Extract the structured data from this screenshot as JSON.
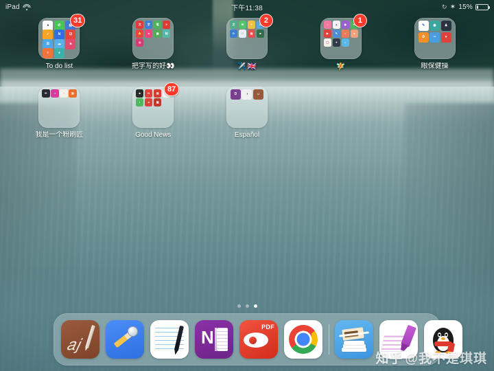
{
  "status_bar": {
    "device_label": "iPad",
    "wifi_icon": "wifi-icon",
    "time": "下午11:38",
    "rotation_lock_icon": "rotation-lock-icon",
    "bluetooth_icon": "bluetooth-icon",
    "battery_percent": "15%",
    "battery_level": 15
  },
  "home_screen": {
    "folders": [
      {
        "name": "To do list",
        "badge": "31",
        "columns": 3,
        "icons": [
          {
            "name": "contacts-app",
            "color": "#ffffff",
            "glyph": "●",
            "glyph_color": "#333333"
          },
          {
            "name": "whatsapp-app",
            "color": "#45c655",
            "glyph": "✆"
          },
          {
            "name": "calendar-app",
            "color": "#3e7bd6",
            "glyph": "▤"
          },
          {
            "name": "reminders-app",
            "color": "#f5a623",
            "glyph": "✓"
          },
          {
            "name": "notes-blue-app",
            "color": "#2f6fe0",
            "glyph": "N"
          },
          {
            "name": "todo-red-app",
            "color": "#e8453c",
            "glyph": "☑"
          },
          {
            "name": "tasks-app",
            "color": "#4ea7e8",
            "glyph": "☰"
          },
          {
            "name": "cloud-app",
            "color": "#58b0e8",
            "glyph": "☁"
          },
          {
            "name": "planner-app",
            "color": "#e24b6e",
            "glyph": "■"
          },
          {
            "name": "orange-list-app",
            "color": "#f0733c",
            "glyph": "≡"
          },
          {
            "name": "teal-app",
            "color": "#3fb0a8",
            "glyph": "●"
          }
        ]
      },
      {
        "name": "把字写的好👀",
        "badge": null,
        "columns": 4,
        "icons": [
          {
            "name": "calligraphy-app",
            "color": "#e23b3b",
            "glyph": "文"
          },
          {
            "name": "blue-write-app",
            "color": "#3f7fd8",
            "glyph": "字"
          },
          {
            "name": "green-write-app",
            "color": "#4eb35c",
            "glyph": "笔"
          },
          {
            "name": "red-x-app",
            "color": "#e0392f",
            "glyph": "✕"
          },
          {
            "name": "shop-app",
            "color": "#e8453c",
            "glyph": "⭐"
          },
          {
            "name": "pink-app",
            "color": "#e8487a",
            "glyph": "a"
          },
          {
            "name": "green-grid-app",
            "color": "#4fae57",
            "glyph": "▦"
          },
          {
            "name": "mint-app",
            "color": "#55b8a8",
            "glyph": "帖"
          },
          {
            "name": "insta-app",
            "color": "#d63b72",
            "glyph": "◎"
          }
        ]
      },
      {
        "name": "✈️🇬🇧",
        "badge": "2",
        "columns": 4,
        "icons": [
          {
            "name": "translate-app",
            "color": "#4fae8d",
            "glyph": "文"
          },
          {
            "name": "green-chat-app",
            "color": "#52c36b",
            "glyph": "✉"
          },
          {
            "name": "yellow-plus-app",
            "color": "#f0c040",
            "glyph": "+"
          },
          {
            "name": "gear-blue-app",
            "color": "#5aa8d8",
            "glyph": "⚙"
          },
          {
            "name": "dict-app",
            "color": "#3d7fd0",
            "glyph": "D"
          },
          {
            "name": "white-card-app",
            "color": "#e8eef2",
            "glyph": "□",
            "glyph_color": "#555555"
          },
          {
            "name": "flag-app",
            "color": "#e05050",
            "glyph": "▤"
          },
          {
            "name": "dark-green-app",
            "color": "#2f6f4a",
            "glyph": "■"
          }
        ]
      },
      {
        "name": "🧚",
        "badge": "1",
        "columns": 4,
        "icons": [
          {
            "name": "pink-music-app",
            "color": "#f07aa0",
            "glyph": "♪"
          },
          {
            "name": "white-art-app",
            "color": "#f2f2f2",
            "glyph": "▲",
            "glyph_color": "#7a4fd0"
          },
          {
            "name": "purple-cam-app",
            "color": "#9b5fd0",
            "glyph": "◉"
          },
          {
            "name": "green-leaf-app",
            "color": "#4fb85e",
            "glyph": "☘"
          },
          {
            "name": "red-play-app",
            "color": "#e0413c",
            "glyph": "▶"
          },
          {
            "name": "blue-draw-app",
            "color": "#4a8fd8",
            "glyph": "✎"
          },
          {
            "name": "coral-app",
            "color": "#f07a5a",
            "glyph": "◐"
          },
          {
            "name": "peach-app",
            "color": "#f0a07a",
            "glyph": "●"
          },
          {
            "name": "white-circle-app",
            "color": "#f5f0ea",
            "glyph": "◯",
            "glyph_color": "#c05a8a"
          },
          {
            "name": "dark-star-app",
            "color": "#2f3b4a",
            "glyph": "✦"
          },
          {
            "name": "sky-app",
            "color": "#5ab8e8",
            "glyph": "☼"
          }
        ]
      },
      {
        "name": "眼保健操",
        "badge": null,
        "columns": 3,
        "icons": [
          {
            "name": "white-note-app",
            "color": "#ffffff",
            "glyph": "✎",
            "glyph_color": "#3a6fd0"
          },
          {
            "name": "teal-eye-app",
            "color": "#3aa8a0",
            "glyph": "◉"
          },
          {
            "name": "dark-person-app",
            "color": "#2a3340",
            "glyph": "♟"
          },
          {
            "name": "orange-timer-app",
            "color": "#f0902a",
            "glyph": "⏱"
          },
          {
            "name": "blue-bar-app",
            "color": "#4a9ee0",
            "glyph": "═"
          },
          {
            "name": "red-heart-app",
            "color": "#e0413c",
            "glyph": "♥"
          }
        ]
      },
      {
        "name": "我是一个粉刷匠",
        "badge": null,
        "columns": 4,
        "icons": [
          {
            "name": "dark-brush-app",
            "color": "#2a2a32",
            "glyph": "✏"
          },
          {
            "name": "magenta-paint-app",
            "color": "#d63b9e",
            "glyph": "◑"
          },
          {
            "name": "white-palette-app",
            "color": "#f5f0e8",
            "glyph": "◔",
            "glyph_color": "#c07a3a"
          },
          {
            "name": "orange-roller-app",
            "color": "#e8702a",
            "glyph": "▤"
          }
        ]
      },
      {
        "name": "Good News",
        "badge": "87",
        "columns": 4,
        "icons": [
          {
            "name": "dark-news-app",
            "color": "#2a2a2a",
            "glyph": "■"
          },
          {
            "name": "red-news-app",
            "color": "#e0413c",
            "glyph": "N"
          },
          {
            "name": "red-paper-app",
            "color": "#d63b30",
            "glyph": "▤"
          },
          {
            "name": "white-f-app",
            "color": "#f5f5f5",
            "glyph": "f",
            "glyph_color": "#e0413c"
          },
          {
            "name": "green-read-app",
            "color": "#4fb85e",
            "glyph": "◖"
          },
          {
            "name": "red-a-app",
            "color": "#e0413c",
            "glyph": "a"
          },
          {
            "name": "crimson-app",
            "color": "#c0392b",
            "glyph": "▦"
          }
        ]
      },
      {
        "name": "Español",
        "badge": null,
        "columns": 3,
        "icons": [
          {
            "name": "purple-lang-app",
            "color": "#7a3f8f",
            "glyph": "D"
          },
          {
            "name": "white-globe-app",
            "color": "#f0f0f0",
            "glyph": "◑",
            "glyph_color": "#555555"
          },
          {
            "name": "brown-face-app",
            "color": "#9a5a3a",
            "glyph": "☺"
          }
        ]
      }
    ],
    "page_dots": {
      "count": 3,
      "active_index": 2
    }
  },
  "dock": {
    "apps": [
      {
        "name": "notability-app",
        "label": "Notability"
      },
      {
        "name": "paper-app",
        "label": "Paper"
      },
      {
        "name": "notes-writer-app",
        "label": "Notes Writer"
      },
      {
        "name": "onenote-app",
        "label": "OneNote",
        "letter": "N"
      },
      {
        "name": "pdf-expert-app",
        "label": "PDF Expert",
        "letter": "PDF"
      },
      {
        "name": "chrome-app",
        "label": "Chrome"
      },
      {
        "name": "scanner-app",
        "label": "Scanner"
      },
      {
        "name": "marker-app",
        "label": "Marker"
      },
      {
        "name": "qq-app",
        "label": "QQ"
      }
    ]
  },
  "watermark": {
    "site": "知乎",
    "handle": "@我不是琪琪"
  }
}
